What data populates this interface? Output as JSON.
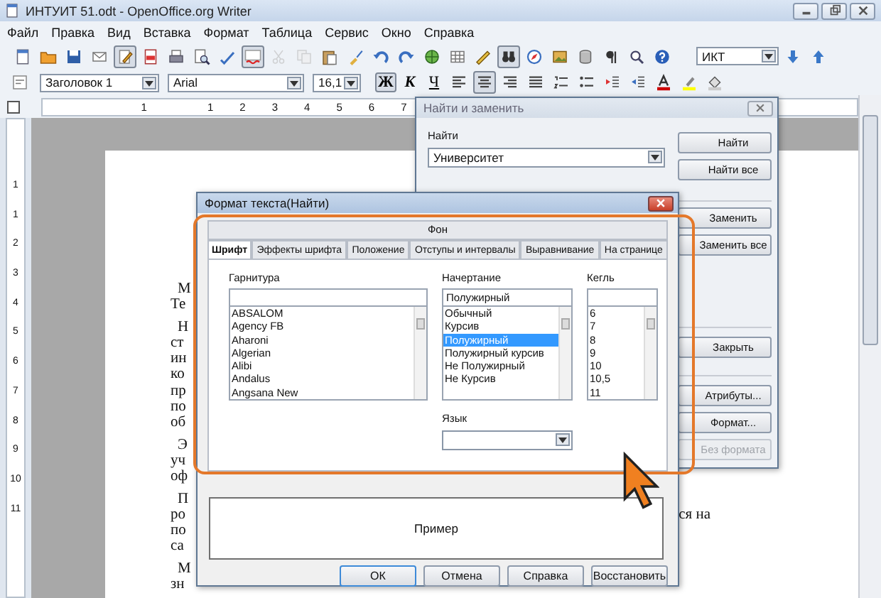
{
  "window": {
    "title": "ИНТУИТ 51.odt - OpenOffice.org Writer"
  },
  "menu": [
    "Файл",
    "Правка",
    "Вид",
    "Вставка",
    "Формат",
    "Таблица",
    "Сервис",
    "Окно",
    "Справка"
  ],
  "toolbar": {
    "edit_mode": true,
    "auto_spellcheck": true,
    "find_replace": true,
    "search_value": "ИКТ"
  },
  "formatting_bar": {
    "style": "Заголовок 1",
    "font": "Arial",
    "size": "16,1",
    "alignment_buttons": [
      {
        "selected": false
      },
      {
        "selected": true
      },
      {
        "selected": false
      },
      {
        "selected": false
      }
    ],
    "buttons": [
      {
        "label": "Ж",
        "kind": "bold",
        "selected": true
      },
      {
        "label": "К",
        "kind": "italic",
        "selected": false
      },
      {
        "label": "Ч",
        "kind": "underline",
        "selected": false
      }
    ]
  },
  "ruler": {
    "horizontal": [
      "1",
      "1",
      "2",
      "3",
      "4",
      "5",
      "6",
      "7"
    ],
    "vertical": [
      "1",
      "1",
      "2",
      "3",
      "4",
      "5",
      "6",
      "7",
      "8",
      "9",
      "10",
      "11"
    ]
  },
  "document": {
    "paragraphs": [
      {
        "lines": [
          {
            "text": "М"
          },
          {
            "text": "Те"
          }
        ]
      },
      {
        "lines": [
          {
            "text": "Н"
          },
          {
            "text": "ст"
          },
          {
            "text": "ин"
          },
          {
            "text": "ко"
          },
          {
            "text": "пр"
          },
          {
            "text": "по"
          },
          {
            "text": "об"
          }
        ]
      },
      {
        "lines": [
          {
            "text": "Э"
          },
          {
            "text": "уч"
          },
          {
            "text": "оф"
          }
        ]
      },
      {
        "lines": [
          {
            "text": "П"
          },
          {
            "text": "ро",
            "tail": "ся на"
          },
          {
            "text": "по"
          },
          {
            "text": "са"
          }
        ]
      },
      {
        "lines": [
          {
            "text": "М"
          },
          {
            "text": "зн"
          }
        ]
      }
    ]
  },
  "find_dialog": {
    "title": "Найти и заменить",
    "search_label": "Найти",
    "search_value": "Университет",
    "button_groups": [
      [
        {
          "label": "Найти",
          "disabled": false
        },
        {
          "label": "Найти все",
          "disabled": false
        }
      ],
      [
        {
          "label": "Заменить",
          "disabled": false
        },
        {
          "label": "Заменить все",
          "disabled": false
        }
      ],
      [
        {
          "label": "Закрыть",
          "disabled": false
        }
      ],
      [
        {
          "label": "Атрибуты...",
          "disabled": false
        },
        {
          "label": "Формат...",
          "disabled": false
        },
        {
          "label": "Без формата",
          "disabled": true
        }
      ]
    ]
  },
  "format_dialog": {
    "title": "Формат текста(Найти)",
    "back_tabs": [
      "Фон"
    ],
    "tabs": [
      {
        "label": "Шрифт",
        "selected": true
      },
      {
        "label": "Эффекты шрифта",
        "selected": false
      },
      {
        "label": "Положение",
        "selected": false
      },
      {
        "label": "Отступы и интервалы",
        "selected": false
      },
      {
        "label": "Выравнивание",
        "selected": false
      },
      {
        "label": "На странице",
        "selected": false
      }
    ],
    "family": {
      "label": "Гарнитура",
      "items": [
        {
          "text": "ABSALOM",
          "selected": false
        },
        {
          "text": "Agency FB",
          "selected": false
        },
        {
          "text": "Aharoni",
          "selected": false
        },
        {
          "text": "Algerian",
          "selected": false
        },
        {
          "text": "Alibi",
          "selected": false
        },
        {
          "text": "Andalus",
          "selected": false
        },
        {
          "text": "Angsana New",
          "selected": false
        }
      ]
    },
    "typeface": {
      "label": "Начертание",
      "value": "Полужирный",
      "items": [
        {
          "text": "Обычный",
          "selected": false
        },
        {
          "text": "Курсив",
          "selected": false
        },
        {
          "text": "Полужирный",
          "selected": true
        },
        {
          "text": "Полужирный курсив",
          "selected": false
        },
        {
          "text": "Не Полужирный",
          "selected": false
        },
        {
          "text": "Не Курсив",
          "selected": false
        }
      ]
    },
    "size": {
      "label": "Кегль",
      "items": [
        {
          "text": "6",
          "selected": false
        },
        {
          "text": "7",
          "selected": false
        },
        {
          "text": "8",
          "selected": false
        },
        {
          "text": "9",
          "selected": false
        },
        {
          "text": "10",
          "selected": false
        },
        {
          "text": "10,5",
          "selected": false
        },
        {
          "text": "11",
          "selected": false
        }
      ]
    },
    "language": {
      "label": "Язык"
    },
    "preview": "Пример",
    "buttons": [
      "ОК",
      "Отмена",
      "Справка",
      "Восстановить"
    ]
  }
}
